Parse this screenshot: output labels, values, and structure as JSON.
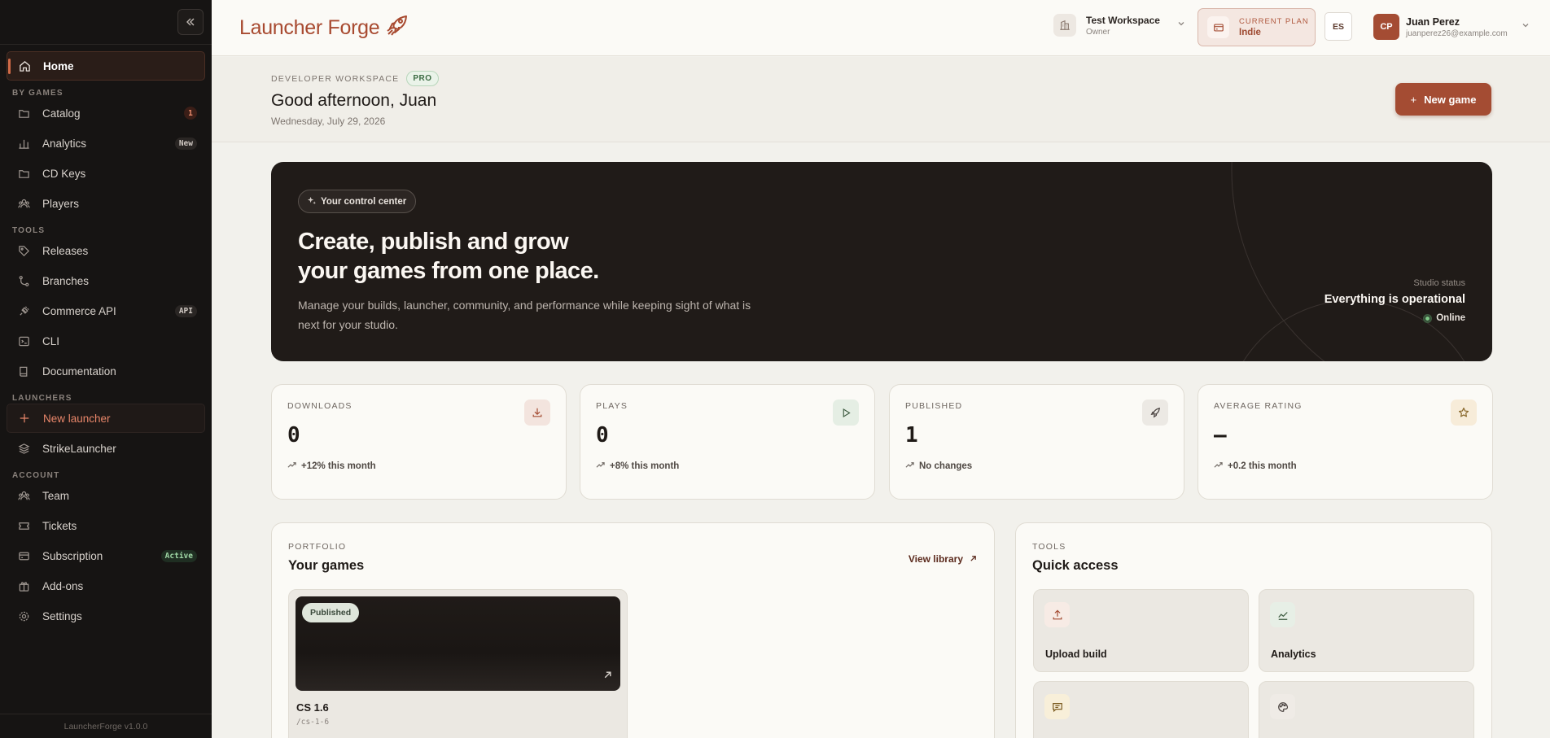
{
  "sidebar": {
    "home": "Home",
    "sections": {
      "games": "BY GAMES",
      "tools": "TOOLS",
      "launchers": "LAUNCHERS",
      "account": "ACCOUNT"
    },
    "games_items": [
      {
        "label": "Catalog",
        "badge": "1"
      },
      {
        "label": "Analytics",
        "badge": "New"
      },
      {
        "label": "CD Keys"
      },
      {
        "label": "Players"
      }
    ],
    "tools_items": [
      {
        "label": "Releases"
      },
      {
        "label": "Branches"
      },
      {
        "label": "Commerce API",
        "badge": "API"
      },
      {
        "label": "CLI"
      },
      {
        "label": "Documentation"
      }
    ],
    "launcher_items": [
      {
        "label": "New launcher"
      },
      {
        "label": "StrikeLauncher"
      }
    ],
    "account_items": [
      {
        "label": "Team"
      },
      {
        "label": "Tickets"
      },
      {
        "label": "Subscription",
        "badge": "Active"
      },
      {
        "label": "Add-ons"
      },
      {
        "label": "Settings"
      }
    ],
    "footer": "LauncherForge v1.0.0"
  },
  "topbar": {
    "logo": "Launcher Forge",
    "workspace": {
      "name": "Test Workspace",
      "role": "Owner"
    },
    "plan": {
      "label": "CURRENT PLAN",
      "value": "Indie"
    },
    "language": "ES",
    "user": {
      "initials": "CP",
      "name": "Juan Perez",
      "email": "juanperez26@example.com"
    }
  },
  "page_header": {
    "eyebrow": "DEVELOPER WORKSPACE",
    "badge": "PRO",
    "greeting": "Good afternoon, Juan",
    "date": "Wednesday, July 29, 2026",
    "new_game": "New game"
  },
  "hero": {
    "chip": "Your control center",
    "title_line1": "Create, publish and grow",
    "title_line2": "your games from one place.",
    "description": "Manage your builds, launcher, community, and performance while keeping sight of what is next for your studio.",
    "status_label": "Studio status",
    "status_value": "Everything is operational",
    "status_online": "Online"
  },
  "stats": [
    {
      "label": "DOWNLOADS",
      "value": "0",
      "trend": "+12% this month",
      "icon": "download-icon"
    },
    {
      "label": "PLAYS",
      "value": "0",
      "trend": "+8% this month",
      "icon": "play-icon"
    },
    {
      "label": "PUBLISHED",
      "value": "1",
      "trend": "No changes",
      "icon": "rocket-icon"
    },
    {
      "label": "AVERAGE RATING",
      "value": "—",
      "trend": "+0.2 this month",
      "icon": "star-icon"
    }
  ],
  "portfolio": {
    "eyebrow": "PORTFOLIO",
    "title": "Your games",
    "view_library": "View library",
    "games": [
      {
        "status": "Published",
        "name": "CS 1.6",
        "slug": "/cs-1-6"
      }
    ]
  },
  "tools_panel": {
    "eyebrow": "TOOLS",
    "title": "Quick access",
    "items": [
      {
        "label": "Upload build",
        "icon": "upload-icon"
      },
      {
        "label": "Analytics",
        "icon": "chart-icon"
      },
      {
        "label": "",
        "icon": "message-icon"
      },
      {
        "label": "",
        "icon": "palette-icon"
      }
    ]
  },
  "colors": {
    "accent": "#a44c33",
    "sidebar_bg": "#161413",
    "hero_bg": "#201b18",
    "page_bg": "#f2f1ec"
  }
}
